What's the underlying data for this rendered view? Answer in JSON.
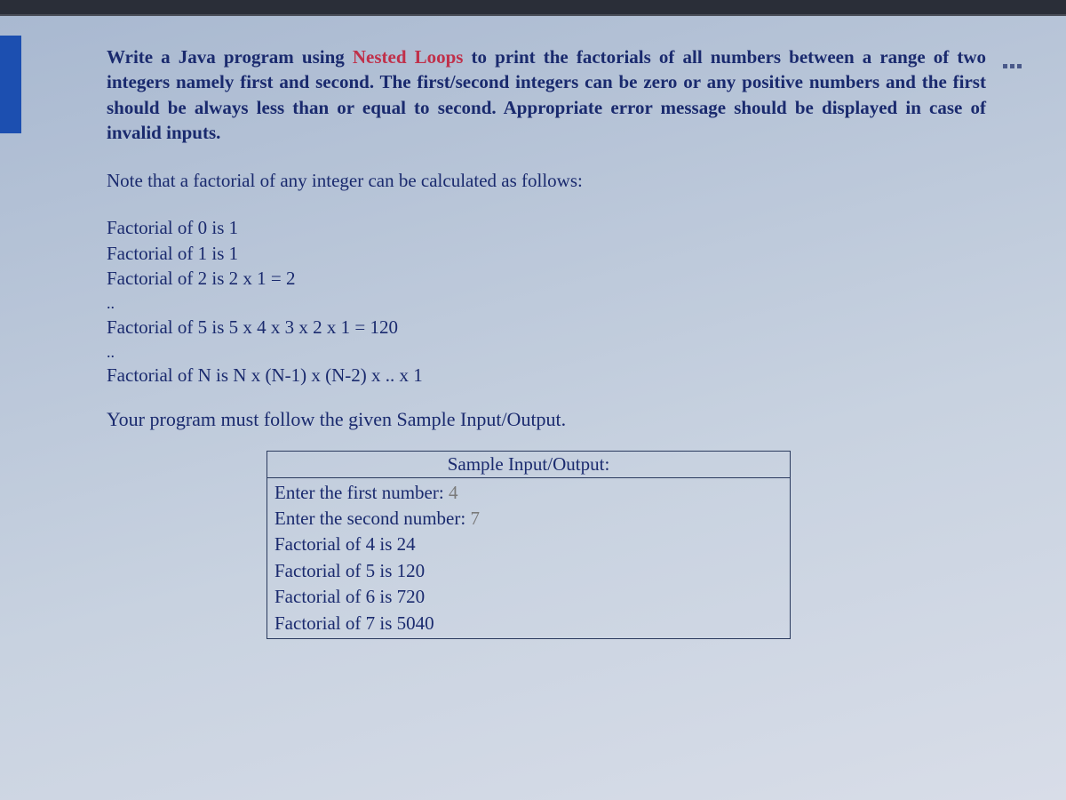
{
  "top_tag": "",
  "more_button_name": "more-icon",
  "paragraph": {
    "p1_a": "Write a Java program using ",
    "p1_red": "Nested Loops",
    "p1_b": " to print the factorials of all numbers between a range of two integers namely ",
    "p1_bold1": "first",
    "p1_c": " and ",
    "p1_bold2": "second",
    "p1_d": ". The ",
    "p1_bold3": "first/second",
    "p1_e": " integers can be zero or any positive numbers and the ",
    "p1_bold4": "first",
    "p1_f": " should be always less than or equal to ",
    "p1_bold5": "second",
    "p1_g": ". Appropriate error message should be displayed in case of invalid inputs."
  },
  "note": "Note that a factorial of any integer can be calculated as follows:",
  "facts": {
    "f0": "Factorial of 0 is 1",
    "f1": "Factorial of 1 is 1",
    "f2": "Factorial of 2 is 2 x 1 = 2",
    "dots1": "..",
    "f5": "Factorial of 5 is 5 x 4 x 3 x 2 x 1 = 120",
    "dots2": "..",
    "fn": "Factorial of N is N x (N-1) x (N-2) x .. x 1"
  },
  "follow": "Your program must follow the given Sample Input/Output.",
  "sample": {
    "header": "Sample Input/Output:",
    "lines": {
      "l1a": "Enter the first number: ",
      "l1b": "4",
      "l2a": "Enter the second number: ",
      "l2b": "7",
      "l3": "Factorial of 4 is 24",
      "l4": "Factorial of 5 is 120",
      "l5": "Factorial of 6 is 720",
      "l6": "Factorial of 7 is 5040"
    }
  }
}
